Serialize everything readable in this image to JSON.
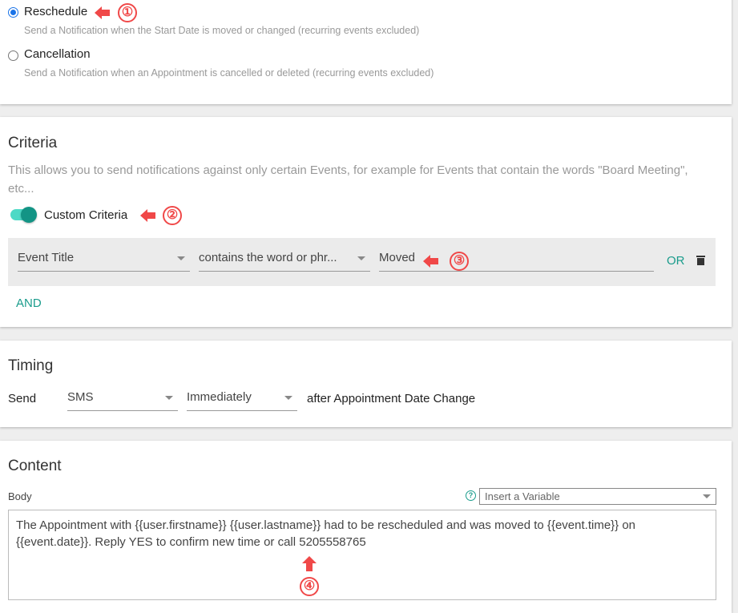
{
  "trigger": {
    "options": [
      {
        "label": "Reschedule",
        "description": "Send a Notification when the Start Date is moved or changed (recurring events excluded)",
        "selected": true
      },
      {
        "label": "Cancellation",
        "description": "Send a Notification when an Appointment is cancelled or deleted (recurring events excluded)",
        "selected": false
      }
    ]
  },
  "criteria": {
    "title": "Criteria",
    "description": "This allows you to send notifications against only certain Events, for example for Events that contain the words \"Board Meeting\", etc...",
    "toggle_label": "Custom Criteria",
    "toggle_on": true,
    "rule": {
      "field": "Event Title",
      "operator": "contains the word or phr...",
      "value": "Moved",
      "or_label": "OR"
    },
    "and_label": "AND"
  },
  "timing": {
    "title": "Timing",
    "send_label": "Send",
    "channel": "SMS",
    "when": "Immediately",
    "suffix": "after Appointment Date Change"
  },
  "content": {
    "title": "Content",
    "body_label": "Body",
    "variable_placeholder": "Insert a Variable",
    "body": "The Appointment with {{user.firstname}} {{user.lastname}} had to be rescheduled and was moved to {{event.time}} on {{event.date}}. Reply YES to confirm new time or call 5205558765"
  },
  "annotations": [
    "①",
    "②",
    "③",
    "④"
  ],
  "colors": {
    "accent": "#1a9c8c",
    "radio": "#1a73e8",
    "annotation": "#f04848"
  }
}
